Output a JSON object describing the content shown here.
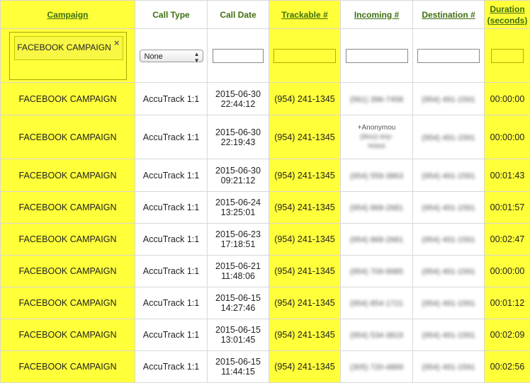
{
  "columns": [
    {
      "key": "campaign",
      "label": "Campaign",
      "sortable": true
    },
    {
      "key": "call_type",
      "label": "Call Type",
      "sortable": false
    },
    {
      "key": "call_date",
      "label": "Call Date",
      "sortable": false
    },
    {
      "key": "trackable",
      "label": "Trackable #",
      "sortable": true
    },
    {
      "key": "incoming",
      "label": "Incoming #",
      "sortable": true
    },
    {
      "key": "destination",
      "label": "Destination #",
      "sortable": true
    },
    {
      "key": "duration",
      "label_line1": "Duration",
      "label_line2": "(seconds)",
      "sortable": true
    }
  ],
  "filters": {
    "campaign_chip": "FACEBOOK CAMPAIGN",
    "chip_close": "×",
    "call_type_select": "None",
    "call_date_value": "",
    "trackable_value": "",
    "incoming_value": "",
    "destination_value": "",
    "duration_value": ""
  },
  "rows": [
    {
      "campaign": "FACEBOOK CAMPAIGN",
      "call_type": "AccuTrack 1:1",
      "date": "2015-06-30",
      "time": "22:44:12",
      "trackable": "(954) 241-1345",
      "incoming": "(561) 396-7458",
      "destination": "(954) 491-1591",
      "duration": "00:00:00"
    },
    {
      "campaign": "FACEBOOK CAMPAIGN",
      "call_type": "AccuTrack 1:1",
      "date": "2015-06-30",
      "time": "22:19:43",
      "trackable": "(954) 241-1345",
      "incoming_l1": "+Anonymou",
      "incoming_l2": "(Anu) ony-",
      "incoming_l3": "mous",
      "destination": "(954) 491-1591",
      "duration": "00:00:00"
    },
    {
      "campaign": "FACEBOOK CAMPAIGN",
      "call_type": "AccuTrack 1:1",
      "date": "2015-06-30",
      "time": "09:21:12",
      "trackable": "(954) 241-1345",
      "incoming": "(954) 559-3863",
      "destination": "(954) 491-1591",
      "duration": "00:01:43"
    },
    {
      "campaign": "FACEBOOK CAMPAIGN",
      "call_type": "AccuTrack 1:1",
      "date": "2015-06-24",
      "time": "13:25:01",
      "trackable": "(954) 241-1345",
      "incoming": "(954) 868-2681",
      "destination": "(954) 491-1591",
      "duration": "00:01:57"
    },
    {
      "campaign": "FACEBOOK CAMPAIGN",
      "call_type": "AccuTrack 1:1",
      "date": "2015-06-23",
      "time": "17:18:51",
      "trackable": "(954) 241-1345",
      "incoming": "(954) 868-2681",
      "destination": "(954) 491-1591",
      "duration": "00:02:47"
    },
    {
      "campaign": "FACEBOOK CAMPAIGN",
      "call_type": "AccuTrack 1:1",
      "date": "2015-06-21",
      "time": "11:48:06",
      "trackable": "(954) 241-1345",
      "incoming": "(954) 709-9985",
      "destination": "(954) 491-1591",
      "duration": "00:00:00"
    },
    {
      "campaign": "FACEBOOK CAMPAIGN",
      "call_type": "AccuTrack 1:1",
      "date": "2015-06-15",
      "time": "14:27:46",
      "trackable": "(954) 241-1345",
      "incoming": "(954) 854-1721",
      "destination": "(954) 491-1591",
      "duration": "00:01:12"
    },
    {
      "campaign": "FACEBOOK CAMPAIGN",
      "call_type": "AccuTrack 1:1",
      "date": "2015-06-15",
      "time": "13:01:45",
      "trackable": "(954) 241-1345",
      "incoming": "(954) 534-3819",
      "destination": "(954) 491-1591",
      "duration": "00:02:09"
    },
    {
      "campaign": "FACEBOOK CAMPAIGN",
      "call_type": "AccuTrack 1:1",
      "date": "2015-06-15",
      "time": "11:44:15",
      "trackable": "(954) 241-1345",
      "incoming": "(305) 720-4869",
      "destination": "(954) 491-1591",
      "duration": "00:02:56"
    }
  ],
  "colors": {
    "highlight_yellow": "#ffff3a",
    "header_text_green": "#3f6f10"
  }
}
